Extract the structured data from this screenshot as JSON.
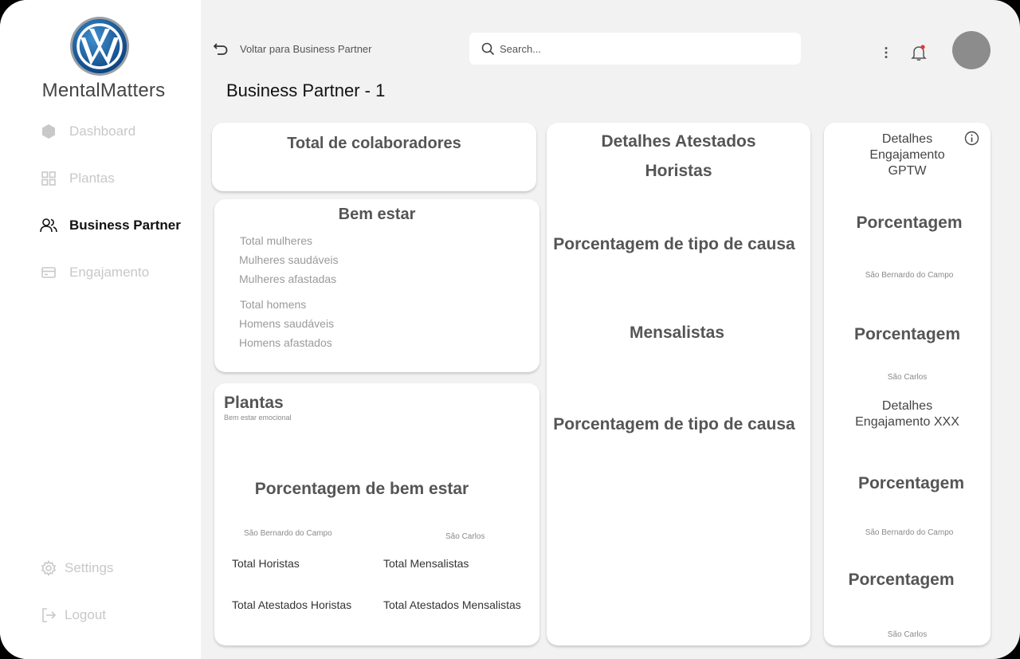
{
  "brand": {
    "name": "MentalMatters",
    "logo_icon": "vw-logo-icon"
  },
  "sidebar": {
    "items": [
      {
        "label": "Dashboard",
        "icon": "dashboard-icon"
      },
      {
        "label": "Plantas",
        "icon": "grid-icon"
      },
      {
        "label": "Business Partner",
        "icon": "users-icon",
        "active": true
      },
      {
        "label": "Engajamento",
        "icon": "card-icon"
      }
    ],
    "settings_label": "Settings",
    "logout_label": "Logout"
  },
  "topbar": {
    "back_label": "Voltar para Business Partner",
    "search_placeholder": "Search..."
  },
  "page": {
    "title": "Business Partner - 1"
  },
  "colaboradores": {
    "title": "Total de colaboradores"
  },
  "bem_estar": {
    "title": "Bem estar",
    "women": [
      "Total mulheres",
      "Mulheres saudáveis",
      "Mulheres afastadas"
    ],
    "men": [
      "Total homens",
      "Homens saudáveis",
      "Homens afastados"
    ]
  },
  "plantas": {
    "title": "Plantas",
    "subtitle": "Bem estar emocional",
    "percent_title": "Porcentagem de bem estar",
    "site_a": "São Bernardo do Campo",
    "site_b": "São Carlos",
    "total_horistas": "Total Horistas",
    "total_mensalistas": "Total Mensalistas",
    "total_atestados_horistas": "Total Atestados Horistas",
    "total_atestados_mensalistas": "Total Atestados Mensalistas"
  },
  "atestados": {
    "title": "Detalhes Atestados",
    "horistas": "Horistas",
    "causa_1": "Porcentagem de tipo de causa",
    "mensalistas": "Mensalistas",
    "causa_2": "Porcentagem de tipo de causa"
  },
  "engajamento": {
    "title_gptw_1": "Detalhes",
    "title_gptw_2": "Engajamento",
    "title_gptw_3": "GPTW",
    "pct_1": "Porcentagem",
    "site_1": "São Bernardo do Campo",
    "pct_2": "Porcentagem",
    "site_2": "São Carlos",
    "title_xxx_1": "Detalhes",
    "title_xxx_2": "Engajamento XXX",
    "pct_3": "Porcentagem",
    "site_3": "São Bernardo do Campo",
    "pct_4": "Porcentagem",
    "site_4": "São Carlos"
  }
}
